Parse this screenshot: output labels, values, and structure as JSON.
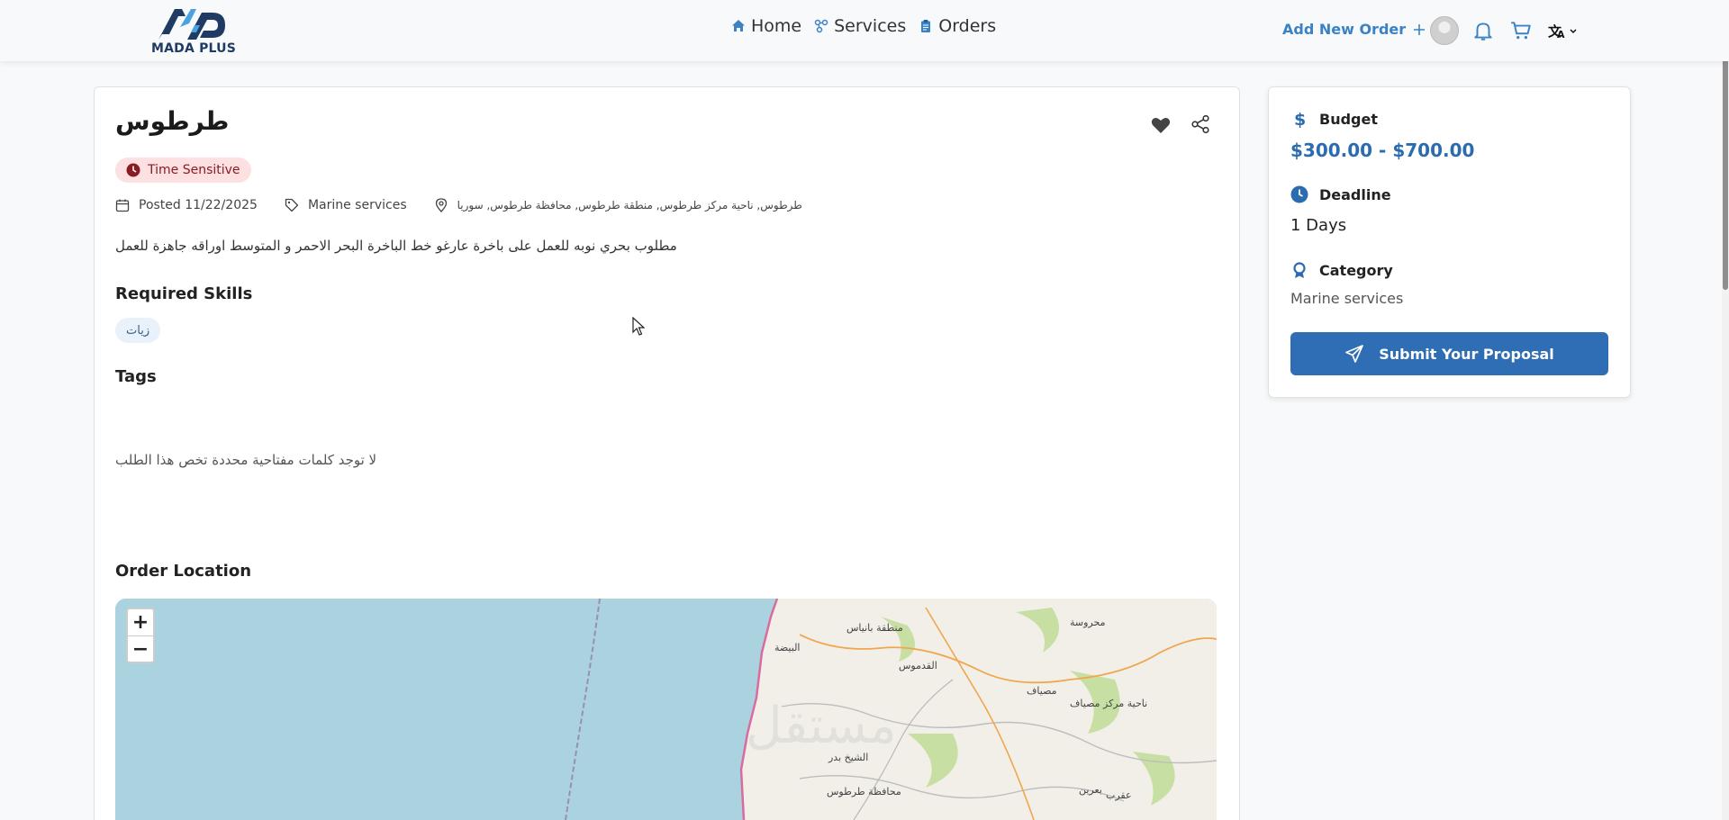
{
  "header": {
    "logo_text": "MADA PLUS",
    "nav": [
      {
        "label": "Home",
        "icon": "home-icon"
      },
      {
        "label": "Services",
        "icon": "services-icon"
      },
      {
        "label": "Orders",
        "icon": "clipboard-icon"
      }
    ],
    "add_order_label": "Add New Order",
    "icons": [
      "avatar",
      "bell-icon",
      "cart-icon",
      "language-icon"
    ]
  },
  "order": {
    "title": "طرطوس",
    "badge": "Time Sensitive",
    "posted": "Posted 11/22/2025",
    "category_tag": "Marine services",
    "location": "طرطوس, ناحية مركز طرطوس, منطقة طرطوس, محافظة طرطوس, سوريا",
    "description": "مطلوب بحري نوبه للعمل على باخرة عارغو خط الباخرة البحر الاحمر و المتوسط اوراقه جاهزة للعمل",
    "required_skills_heading": "Required Skills",
    "skills": [
      "زيات"
    ],
    "tags_heading": "Tags",
    "no_tags_text": "لا توجد كلمات مفتاحية محددة تخص هذا الطلب",
    "location_heading": "Order Location"
  },
  "map": {
    "zoom_in": "+",
    "zoom_out": "−",
    "labels": [
      "منطقة بانياس",
      "البيضة",
      "القدموس",
      "مصياف",
      "محروسة",
      "الشيخ بدر",
      "محافظة طرطوس",
      "عقرب",
      "بعرين",
      "ناحية مركز مصياف"
    ],
    "colors": {
      "sea": "#aad3df",
      "land": "#f2efe9",
      "green": "#c8dfa3",
      "border": "#d86b9f",
      "road": "#f0a64d"
    }
  },
  "sidebar": {
    "budget_label": "Budget",
    "budget_value": "$300.00 - $700.00",
    "deadline_label": "Deadline",
    "deadline_value": "1 Days",
    "category_label": "Category",
    "category_value": "Marine services",
    "submit_label": "Submit Your Proposal"
  },
  "colors": {
    "accent": "#2f6db5",
    "badge_bg": "#fde0e2",
    "badge_text": "#8a1c23"
  }
}
